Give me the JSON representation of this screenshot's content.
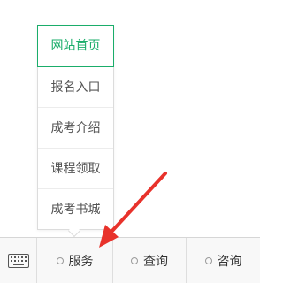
{
  "popup_menu": {
    "items": [
      {
        "label": "网站首页",
        "active": true
      },
      {
        "label": "报名入口",
        "active": false
      },
      {
        "label": "成考介绍",
        "active": false
      },
      {
        "label": "课程领取",
        "active": false
      },
      {
        "label": "成考书城",
        "active": false
      }
    ]
  },
  "bottom_bar": {
    "keyboard_icon": "keyboard-icon",
    "menus": [
      {
        "label": "服务",
        "icon": "dot-icon"
      },
      {
        "label": "查询",
        "icon": "dot-icon"
      },
      {
        "label": "咨询",
        "icon": "dot-icon"
      }
    ]
  },
  "colors": {
    "active_accent": "#1aad6a",
    "annotation_arrow": "#e8322b"
  }
}
